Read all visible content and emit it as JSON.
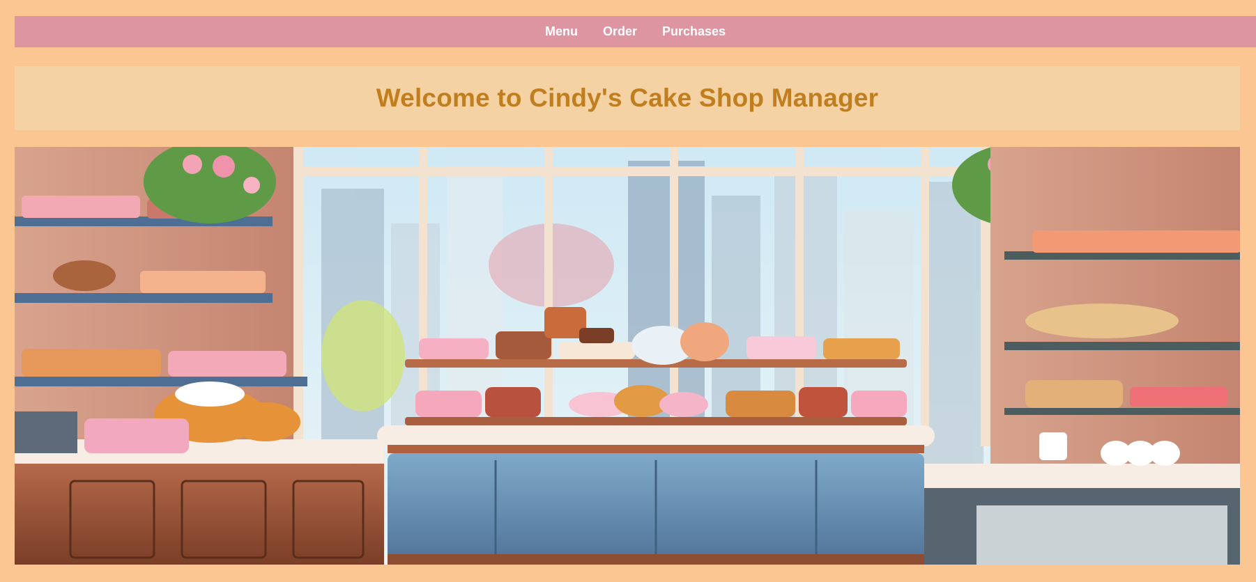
{
  "nav": {
    "items": [
      {
        "label": "Menu"
      },
      {
        "label": "Order"
      },
      {
        "label": "Purchases"
      }
    ]
  },
  "header": {
    "title": "Welcome to Cindy's Cake Shop Manager"
  },
  "hero": {
    "icon": "bakery-interior-illustration"
  },
  "colors": {
    "page_background": "#fcc693",
    "nav_background": "#dd96a1",
    "nav_text": "#ffffff",
    "header_background": "#f5d2a4",
    "header_text": "#c17e1f"
  }
}
